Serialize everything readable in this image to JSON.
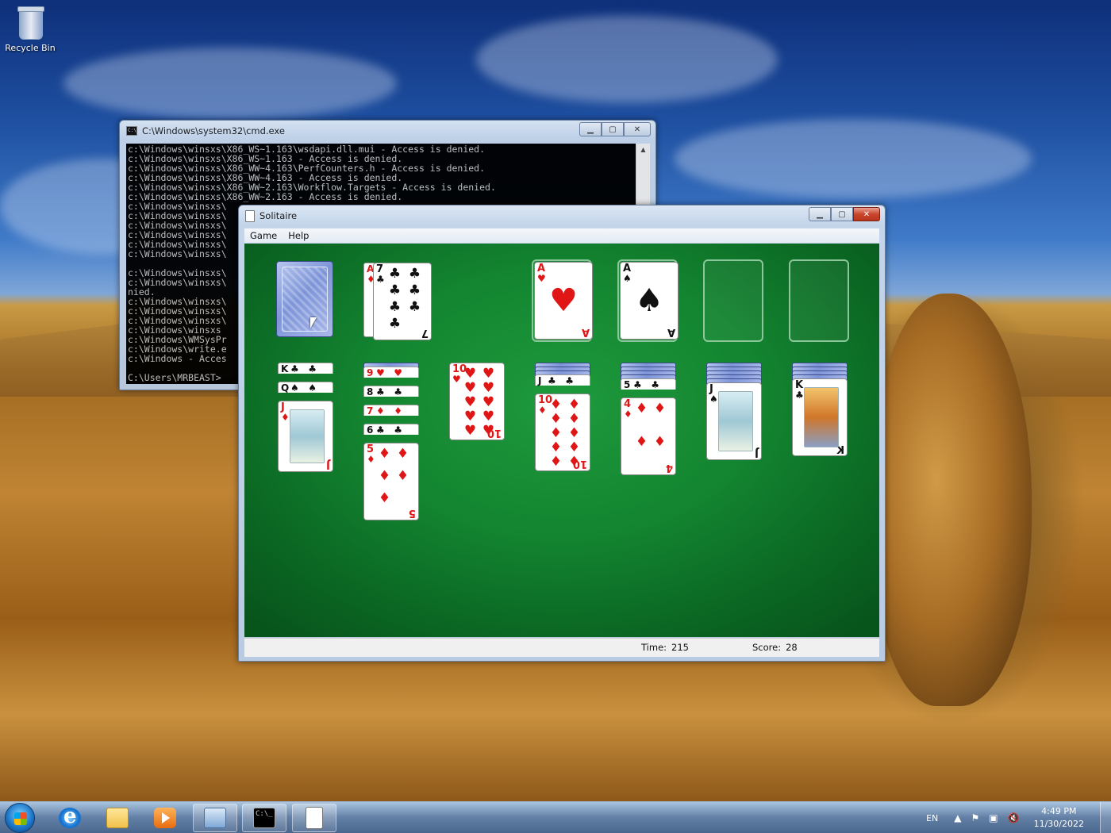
{
  "desktop": {
    "icons": [
      {
        "label": "Recycle Bin",
        "icon": "recycle-bin-icon"
      }
    ]
  },
  "cmd_window": {
    "title": "C:\\Windows\\system32\\cmd.exe",
    "console_lines": [
      "c:\\Windows\\winsxs\\X86_WS~1.163\\wsdapi.dll.mui - Access is denied.",
      "c:\\Windows\\winsxs\\X86_WS~1.163 - Access is denied.",
      "c:\\Windows\\winsxs\\X86_WW~4.163\\PerfCounters.h - Access is denied.",
      "c:\\Windows\\winsxs\\X86_WW~4.163 - Access is denied.",
      "c:\\Windows\\winsxs\\X86_WW~2.163\\Workflow.Targets - Access is denied.",
      "c:\\Windows\\winsxs\\X86_WW~2.163 - Access is denied.",
      "c:\\Windows\\winsxs\\",
      "c:\\Windows\\winsxs\\",
      "c:\\Windows\\winsxs\\",
      "c:\\Windows\\winsxs\\",
      "c:\\Windows\\winsxs\\",
      "c:\\Windows\\winsxs\\",
      "",
      "c:\\Windows\\winsxs\\",
      "c:\\Windows\\winsxs\\",
      "nied.",
      "c:\\Windows\\winsxs\\",
      "c:\\Windows\\winsxs\\",
      "c:\\Windows\\winsxs\\",
      "c:\\Windows\\winsxs",
      "c:\\Windows\\WMSysPr",
      "c:\\Windows\\write.e",
      "c:\\Windows - Acces",
      "",
      "C:\\Users\\MRBEAST>"
    ]
  },
  "solitaire_window": {
    "title": "Solitaire",
    "menu": [
      "Game",
      "Help"
    ],
    "status": {
      "time_label": "Time:",
      "time_value": "215",
      "score_label": "Score:",
      "score_value": "28"
    },
    "stock": {
      "state": "face-down"
    },
    "waste": [
      {
        "rank": "A",
        "suit": "♦",
        "color": "red"
      },
      {
        "rank": "7",
        "suit": "♣",
        "color": "black"
      }
    ],
    "foundations": [
      {
        "rank": "A",
        "suit": "♥",
        "color": "red"
      },
      {
        "rank": "A",
        "suit": "♠",
        "color": "black"
      },
      {
        "rank": "",
        "suit": "",
        "color": ""
      },
      {
        "rank": "",
        "suit": "",
        "color": ""
      }
    ],
    "tableau": [
      {
        "hidden": 0,
        "cards": [
          {
            "rank": "K",
            "suit": "♣",
            "color": "black"
          },
          {
            "rank": "Q",
            "suit": "♠",
            "color": "black"
          },
          {
            "rank": "J",
            "suit": "♦",
            "color": "red"
          }
        ]
      },
      {
        "hidden": 1,
        "cards": [
          {
            "rank": "9",
            "suit": "♥",
            "color": "red"
          },
          {
            "rank": "8",
            "suit": "♣",
            "color": "black"
          },
          {
            "rank": "7",
            "suit": "♦",
            "color": "red"
          },
          {
            "rank": "6",
            "suit": "♣",
            "color": "black"
          },
          {
            "rank": "5",
            "suit": "♦",
            "color": "red"
          }
        ]
      },
      {
        "hidden": 0,
        "cards": [
          {
            "rank": "10",
            "suit": "♥",
            "color": "red"
          }
        ]
      },
      {
        "hidden": 3,
        "cards": [
          {
            "rank": "J",
            "suit": "♣",
            "color": "black"
          },
          {
            "rank": "10",
            "suit": "♦",
            "color": "red"
          }
        ]
      },
      {
        "hidden": 4,
        "cards": [
          {
            "rank": "5",
            "suit": "♣",
            "color": "black"
          },
          {
            "rank": "4",
            "suit": "♦",
            "color": "red"
          }
        ]
      },
      {
        "hidden": 5,
        "cards": [
          {
            "rank": "J",
            "suit": "♠",
            "color": "black"
          }
        ]
      },
      {
        "hidden": 4,
        "cards": [
          {
            "rank": "K",
            "suit": "♣",
            "color": "black"
          }
        ]
      }
    ]
  },
  "taskbar": {
    "pinned": [
      "start-button",
      "internet-explorer-icon",
      "windows-explorer-icon",
      "media-player-icon",
      "remote-desktop-icon",
      "cmd-icon",
      "solitaire-icon"
    ],
    "language": "EN",
    "time": "4:49 PM",
    "date": "11/30/2022"
  }
}
